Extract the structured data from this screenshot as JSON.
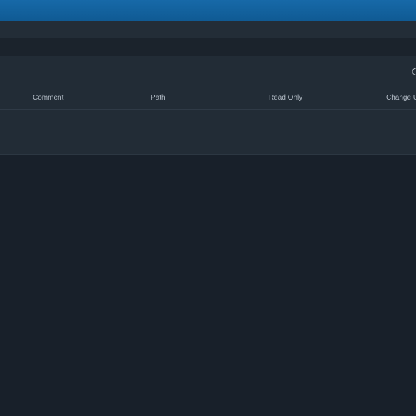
{
  "header": {
    "partial_icon": "search-icon"
  },
  "table": {
    "columns": [
      "Comment",
      "Path",
      "Read Only",
      "Change Us"
    ],
    "rows": [
      {},
      {}
    ]
  }
}
